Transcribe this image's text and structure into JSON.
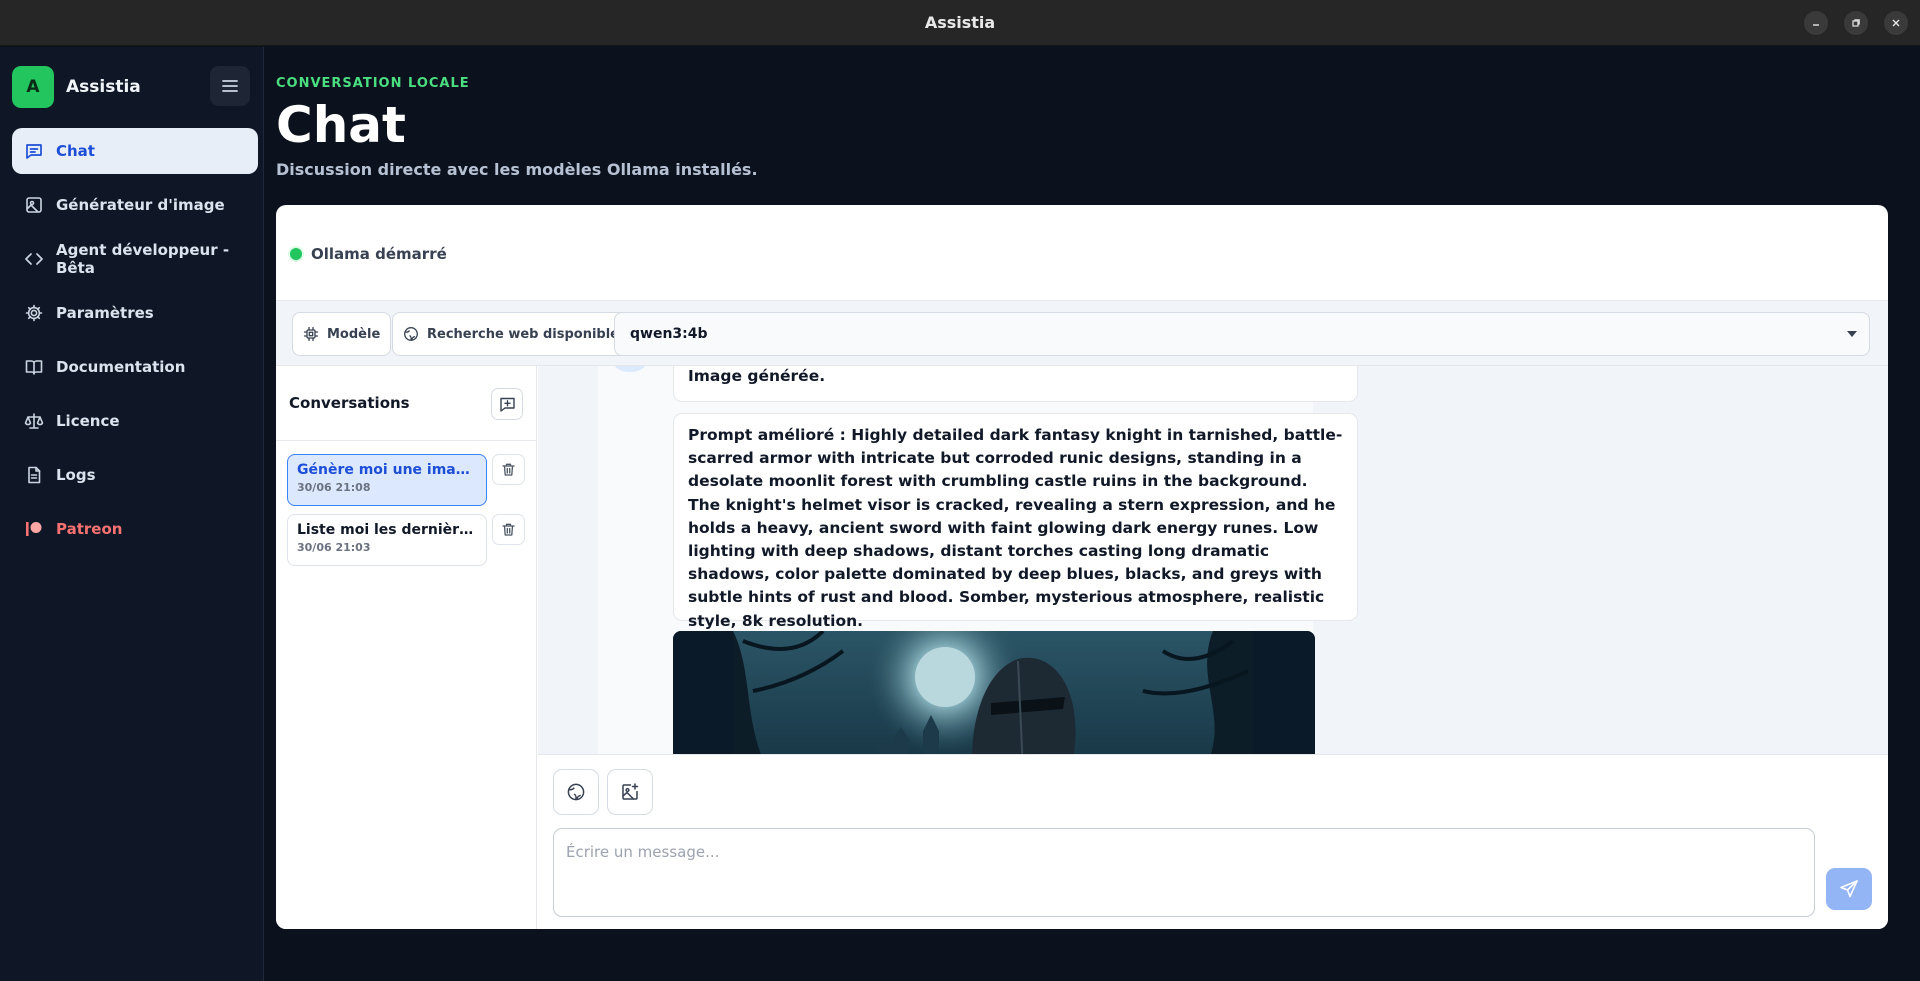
{
  "window": {
    "title": "Assistia"
  },
  "sidebar": {
    "brand_initial": "A",
    "brand_name": "Assistia",
    "items": [
      {
        "label": "Chat",
        "icon": "chat-icon",
        "active": true
      },
      {
        "label": "Générateur d'image",
        "icon": "image-icon"
      },
      {
        "label": "Agent développeur - Bêta",
        "icon": "code-icon"
      },
      {
        "label": "Paramètres",
        "icon": "gear-icon"
      },
      {
        "label": "Documentation",
        "icon": "book-icon"
      },
      {
        "label": "Licence",
        "icon": "scale-icon"
      },
      {
        "label": "Logs",
        "icon": "file-text-icon"
      },
      {
        "label": "Patreon",
        "icon": "patreon-icon"
      }
    ]
  },
  "header": {
    "eyebrow": "CONVERSATION LOCALE",
    "title": "Chat",
    "subtitle": "Discussion directe avec les modèles Ollama installés."
  },
  "status": {
    "text": "Ollama démarré",
    "color": "#22c55e"
  },
  "toolbar": {
    "model_label": "Modèle",
    "web_search_label": "Recherche web disponible",
    "selected_model": "qwen3:4b"
  },
  "conversations": {
    "title": "Conversations",
    "items": [
      {
        "title": "Génère moi une image d'…",
        "date": "30/06 21:08",
        "active": true
      },
      {
        "title": "Liste moi les dernières a…",
        "date": "30/06 21:03",
        "active": false
      }
    ]
  },
  "messages": {
    "image_caption": "Image générée.",
    "improved_prompt": "Prompt amélioré : Highly detailed dark fantasy knight in tarnished, battle-scarred armor with intricate but corroded runic designs, standing in a desolate moonlit forest with crumbling castle ruins in the background. The knight's helmet visor is cracked, revealing a stern expression, and he holds a heavy, ancient sword with faint glowing dark energy runes. Low lighting with deep shadows, distant torches casting long dramatic shadows, color palette dominated by deep blues, blacks, and greys with subtle hints of rust and blood. Somber, mysterious atmosphere, realistic style, 8k resolution."
  },
  "composer": {
    "placeholder": "Écrire un message..."
  },
  "colors": {
    "accent": "#1d4ed8",
    "brand": "#22c55e",
    "sidebar_bg": "#0f1726"
  }
}
